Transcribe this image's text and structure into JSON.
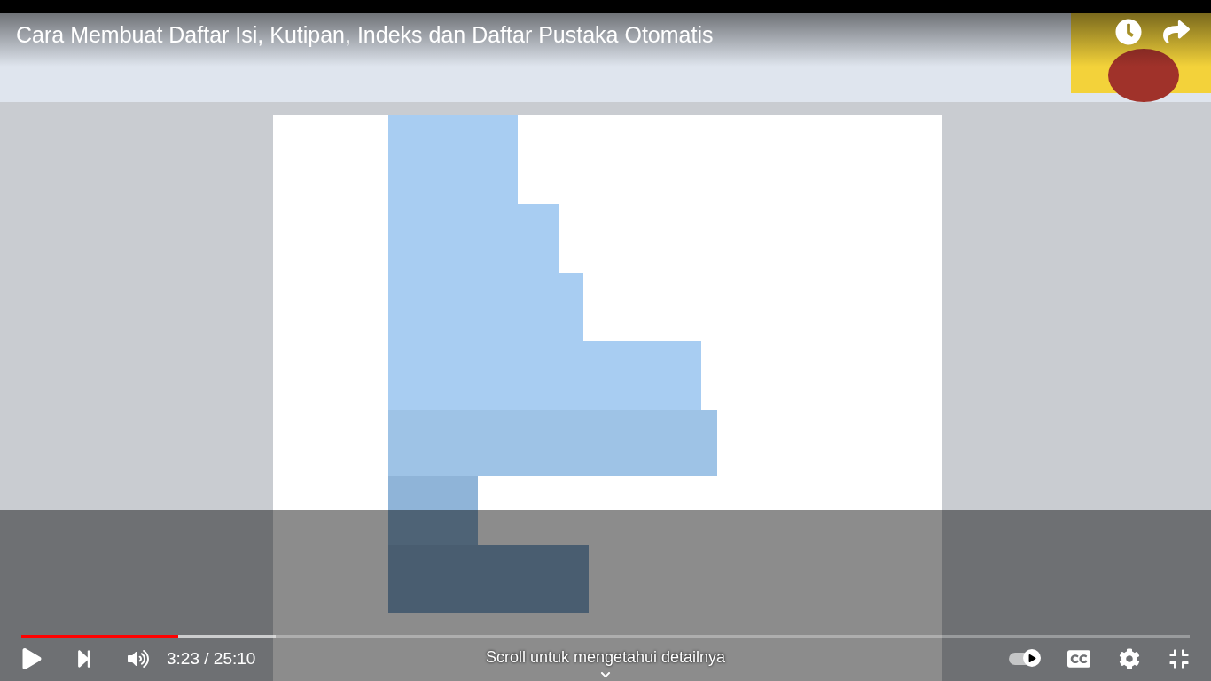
{
  "title": "Cara Membuat Daftar Isi, Kutipan, Indeks dan Daftar Pustaka Otomatis",
  "progress": {
    "level": 0.134
  },
  "time": {
    "current": "3:23",
    "separator": "/",
    "duration": "25:10"
  },
  "hint": "Scroll untuk mengetahui detailnya",
  "autoplay": {
    "on": true
  }
}
